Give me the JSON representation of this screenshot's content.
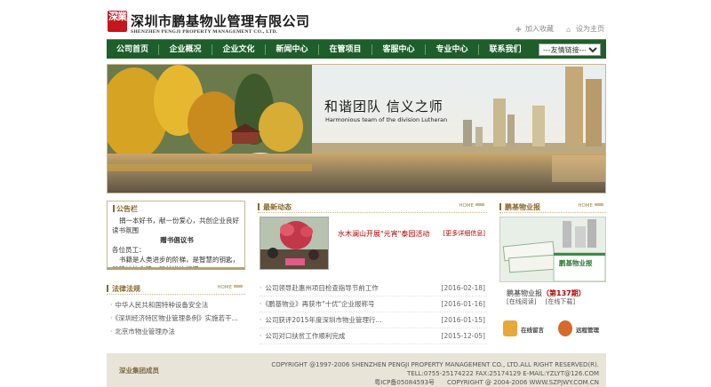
{
  "header": {
    "seal_text": "深業",
    "company_cn": "深圳市鹏基物业管理有限公司",
    "company_en": "SHENZHEN PENGJI PROPERTY MANAGEMENT CO., LTD.",
    "links": [
      {
        "label": "加入收藏",
        "icon": "bookmark-icon"
      },
      {
        "label": "设为主页",
        "icon": "home-icon"
      }
    ]
  },
  "nav": {
    "items": [
      "公司首页",
      "企业概况",
      "企业文化",
      "新闻中心",
      "在管项目",
      "客服中心",
      "专业中心",
      "联系我们"
    ],
    "select_value": "---友情链接---"
  },
  "banner": {
    "slogan": "和谐团队  信义之师",
    "slogan_en": "Harmonious team of the division Lutheran"
  },
  "notice": {
    "title": "公告栏",
    "line1": "捐一本好书，献一份爱心，共创企业良好读书氛围",
    "line2": "赠书倡议书",
    "line3": "各位员工：",
    "line4": "书籍是人类进步的阶梯，是智慧的钥匙，是精神的食粮，是前进的灯塔......"
  },
  "law": {
    "title": "法律法规",
    "more": "HOME",
    "items": [
      "中华人民共和国特种设备安全法",
      "《深圳经济特区物业管理条例》实施若干...",
      "北京市物业管理办法"
    ]
  },
  "news": {
    "title": "最新动态",
    "more": "HOME",
    "feature_title": "水木澜山开展\"元宵\"泰园活动",
    "feature_more": "[更多详细信息]",
    "items": [
      {
        "title": "公司领导赴惠州项目检查指导节前工作",
        "date": "[2016-02-18]"
      },
      {
        "title": "《鹏基物业》再获市\"十优\"企业报称号",
        "date": "[2016-01-16]"
      },
      {
        "title": "公司获评2015年度深圳市物业管理行...",
        "date": "[2016-01-15]"
      },
      {
        "title": "公司对口扶贫工作顺利完成",
        "date": "[2015-12-05]"
      }
    ]
  },
  "magazine": {
    "title": "鹏基物业报",
    "more": "HOME",
    "cover_name": "鹏基物业报",
    "issue_prefix": "鹏基物业报",
    "issue": "（第137期）",
    "read_online": "[在线阅读]",
    "download": "[在线下载]",
    "buttons": [
      {
        "label": "在线留言",
        "icon": "message-icon"
      },
      {
        "label": "远程管理",
        "icon": "remote-management-icon"
      }
    ]
  },
  "footer": {
    "group": "深业集团成员",
    "copyright": "COPYRIGHT @1997-2006 SHENZHEN PENGJI PROPERTY MANAGEMENT CO., LTD.ALL RIGHT RESERVED(R).",
    "contact": "TELL:0755-25174222 FAX:25174129 E-MAIL:YZLYT@126.COM",
    "icp": "粤ICP备05084593号",
    "site": "COPYRIGHT @ 2004-2006 WWW.SZPJWY.COM.CN"
  },
  "colors": {
    "nav_bg": "#1d5e2a",
    "accent_brown": "#8b6a2a",
    "feature_red": "#b30000",
    "footer_bg": "#e9e4d8"
  }
}
